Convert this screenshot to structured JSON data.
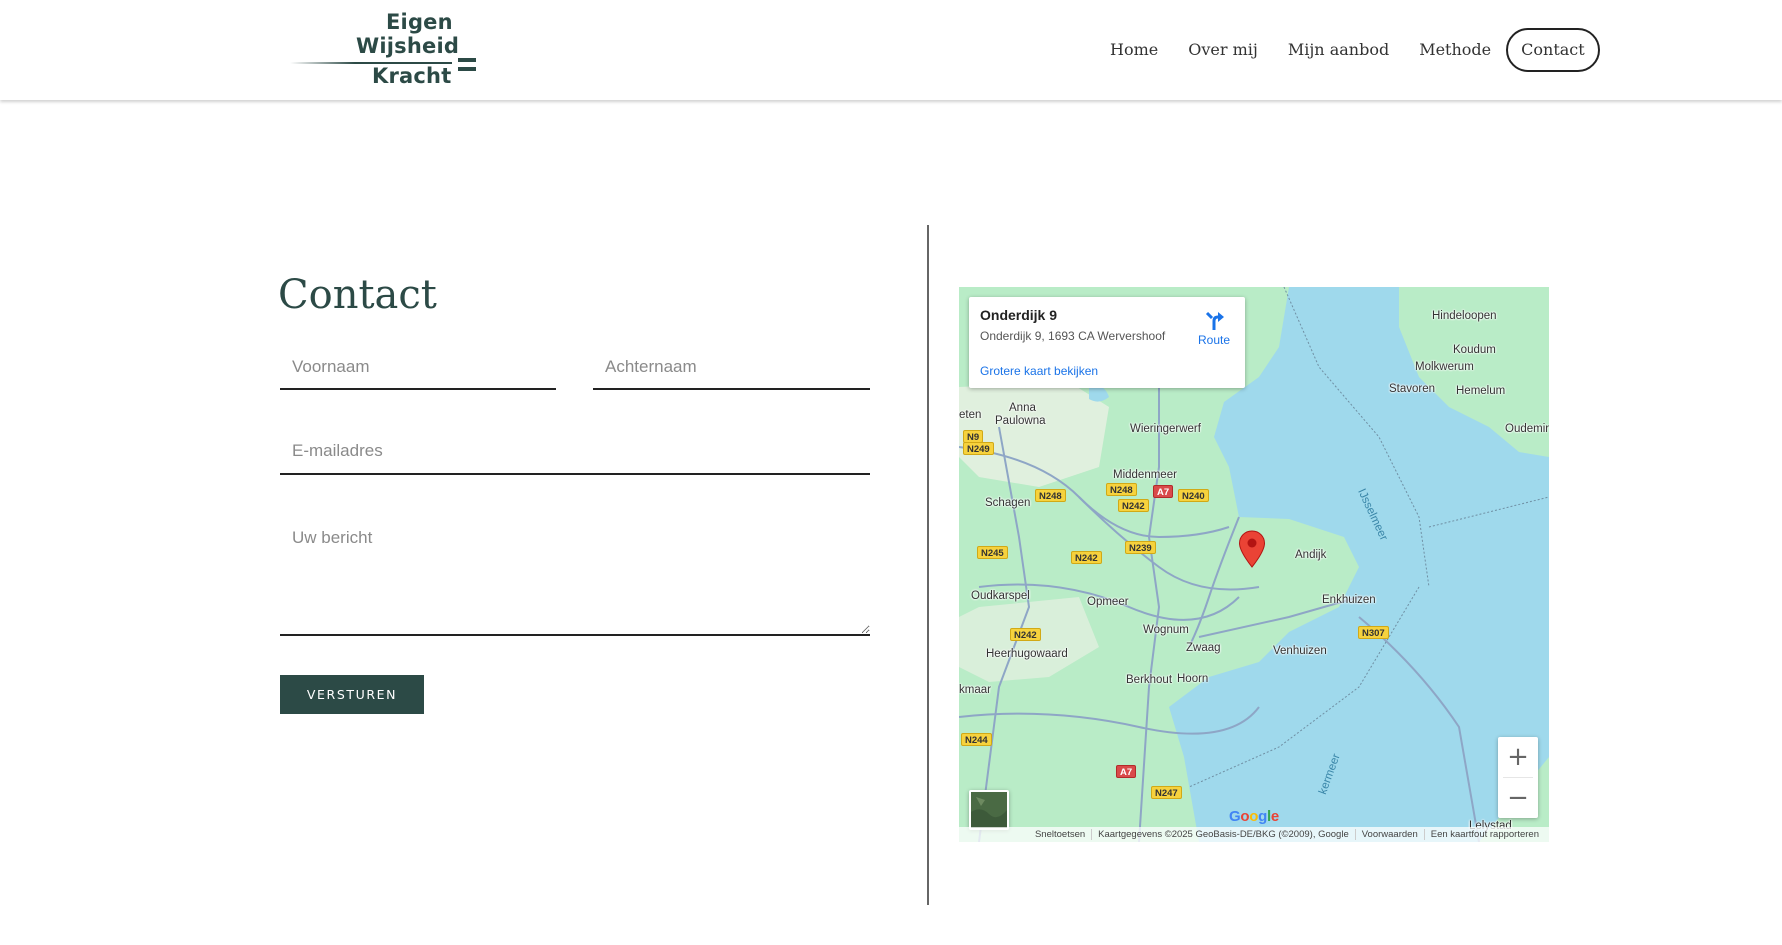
{
  "header": {
    "logo": {
      "line1": "Eigen",
      "line2": "Wijsheid",
      "line3": "Kracht"
    },
    "nav": [
      {
        "label": "Home"
      },
      {
        "label": "Over mij"
      },
      {
        "label": "Mijn aanbod"
      },
      {
        "label": "Methode"
      },
      {
        "label": "Contact",
        "active": true
      }
    ]
  },
  "contact": {
    "title": "Contact",
    "fields": {
      "first_name": {
        "placeholder": "Voornaam",
        "value": ""
      },
      "last_name": {
        "placeholder": "Achternaam",
        "value": ""
      },
      "email": {
        "placeholder": "E-mailadres",
        "value": ""
      },
      "message": {
        "placeholder": "Uw bericht",
        "value": ""
      }
    },
    "submit_label": "VERSTUREN"
  },
  "map": {
    "card": {
      "title": "Onderdijk 9",
      "address": "Onderdijk 9, 1693 CA Wervershoof",
      "route_label": "Route",
      "larger_map_link": "Grotere kaart bekijken"
    },
    "places": {
      "hindeloopen": "Hindeloopen",
      "koudum": "Koudum",
      "molkwerum": "Molkwerum",
      "stavoren": "Stavoren",
      "hemelum": "Hemelum",
      "oudemirdum": "Oudemir",
      "anna_paulowna_1": "Anna",
      "anna_paulowna_2": "Paulowna",
      "petten": "eten",
      "wieringerwerf": "Wieringerwerf",
      "middenmeer": "Middenmeer",
      "schagen": "Schagen",
      "andijk": "Andijk",
      "oudkarspel": "Oudkarspel",
      "opmeer": "Opmeer",
      "enkhuizen": "Enkhuizen",
      "wognum": "Wognum",
      "zwaag": "Zwaag",
      "venhuizen": "Venhuizen",
      "heerhugowaard": "Heerhugowaard",
      "berkhout": "Berkhout",
      "hoorn": "Hoorn",
      "alkmaar": "kmaar",
      "lelystad": "Lelystad"
    },
    "water_labels": {
      "ijsselmeer": "IJsselmeer",
      "markermeer": "kermeer"
    },
    "roads": {
      "n9": "N9",
      "n249": "N249",
      "n248a": "N248",
      "n248b": "N248",
      "a7a": "A7",
      "n240": "N240",
      "n242a": "N242",
      "n242b": "N242",
      "n242c": "N242",
      "n245": "N245",
      "n239": "N239",
      "n307": "N307",
      "n244": "N244",
      "a7b": "A7",
      "n247": "N247"
    },
    "zoom_in": "+",
    "zoom_out": "−",
    "google_logo": {
      "g1": "G",
      "o1": "o",
      "o2": "o",
      "g2": "g",
      "l": "l",
      "e": "e"
    },
    "attribution": [
      "Sneltoetsen",
      "Kaartgegevens ©2025 GeoBasis-DE/BKG (©2009), Google",
      "Voorwaarden",
      "Een kaartfout rapporteren"
    ],
    "colors": {
      "water": "#9fd9ec",
      "land": "#b9ecc7",
      "pin": "#ea4335",
      "accent": "#2c4a46"
    }
  }
}
